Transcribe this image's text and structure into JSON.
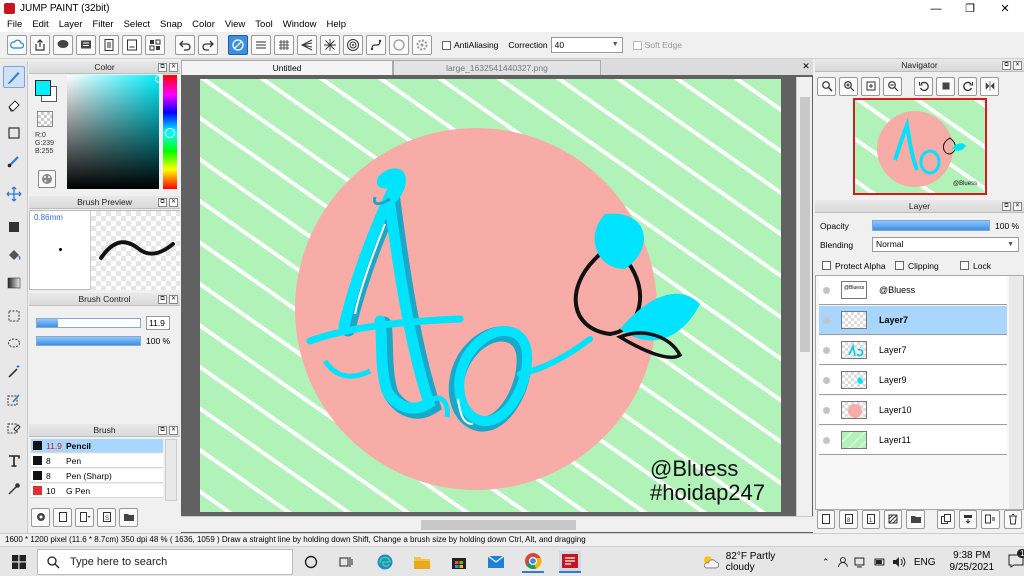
{
  "window": {
    "title": "JUMP PAINT (32bit)",
    "min": "—",
    "max": "❐",
    "close": "✕"
  },
  "menu": [
    "File",
    "Edit",
    "Layer",
    "Filter",
    "Select",
    "Snap",
    "Color",
    "View",
    "Tool",
    "Window",
    "Help"
  ],
  "toolbar": {
    "antialiasing_label": "AntiAliasing",
    "correction_label": "Correction",
    "correction_value": "40",
    "softedge_label": "Soft Edge"
  },
  "color_panel": {
    "title": "Color",
    "r": "R:0",
    "g": "G:239",
    "b": "B:255",
    "fg_color": "#00efff"
  },
  "brush_preview": {
    "title": "Brush Preview",
    "size": "0.86mm"
  },
  "brush_control": {
    "title": "Brush Control",
    "size_value": "11.9",
    "opacity_value": "100 %",
    "size_fraction": 0.2,
    "opacity_fraction": 1.0
  },
  "brush_panel": {
    "title": "Brush",
    "items": [
      {
        "size": "11.9",
        "name": "Pencil",
        "color": "#111111",
        "selected": true
      },
      {
        "size": "8",
        "name": "Pen",
        "color": "#111111"
      },
      {
        "size": "8",
        "name": "Pen (Sharp)",
        "color": "#111111"
      },
      {
        "size": "10",
        "name": "G Pen",
        "color": "#e03030"
      }
    ]
  },
  "doc_tabs": [
    {
      "label": "Untitled"
    },
    {
      "label": "large_1632541440327.png"
    }
  ],
  "artwork": {
    "line1": "@Bluess",
    "line2": "#hoidap247",
    "bg_color": "#b1f2b9",
    "circle_color": "#f8aca7",
    "ink_color": "#00e3ff"
  },
  "navigator": {
    "title": "Navigator"
  },
  "layer_panel": {
    "title": "Layer",
    "opacity_label": "Opacity",
    "opacity_value": "100 %",
    "blending_label": "Blending",
    "blending_value": "Normal",
    "protect_alpha": "Protect Alpha",
    "clipping": "Clipping",
    "lock": "Lock",
    "layers": [
      {
        "name": "@Bluess"
      },
      {
        "name": "Layer7",
        "selected": true
      },
      {
        "name": "Layer7"
      },
      {
        "name": "Layer9"
      },
      {
        "name": "Layer10"
      },
      {
        "name": "Layer11"
      }
    ]
  },
  "status": {
    "text": "1600 * 1200 pixel   (11.6 * 8.7cm)   350 dpi   48 %   ( 1636, 1059 )   Draw a straight line by holding down Shift, Change a brush size by holding down Ctrl, Alt, and dragging"
  },
  "taskbar": {
    "search_placeholder": "Type here to search",
    "weather": "82°F  Partly cloudy",
    "lang": "ENG",
    "time": "9:38 PM",
    "date": "9/25/2021",
    "notif": "1"
  }
}
